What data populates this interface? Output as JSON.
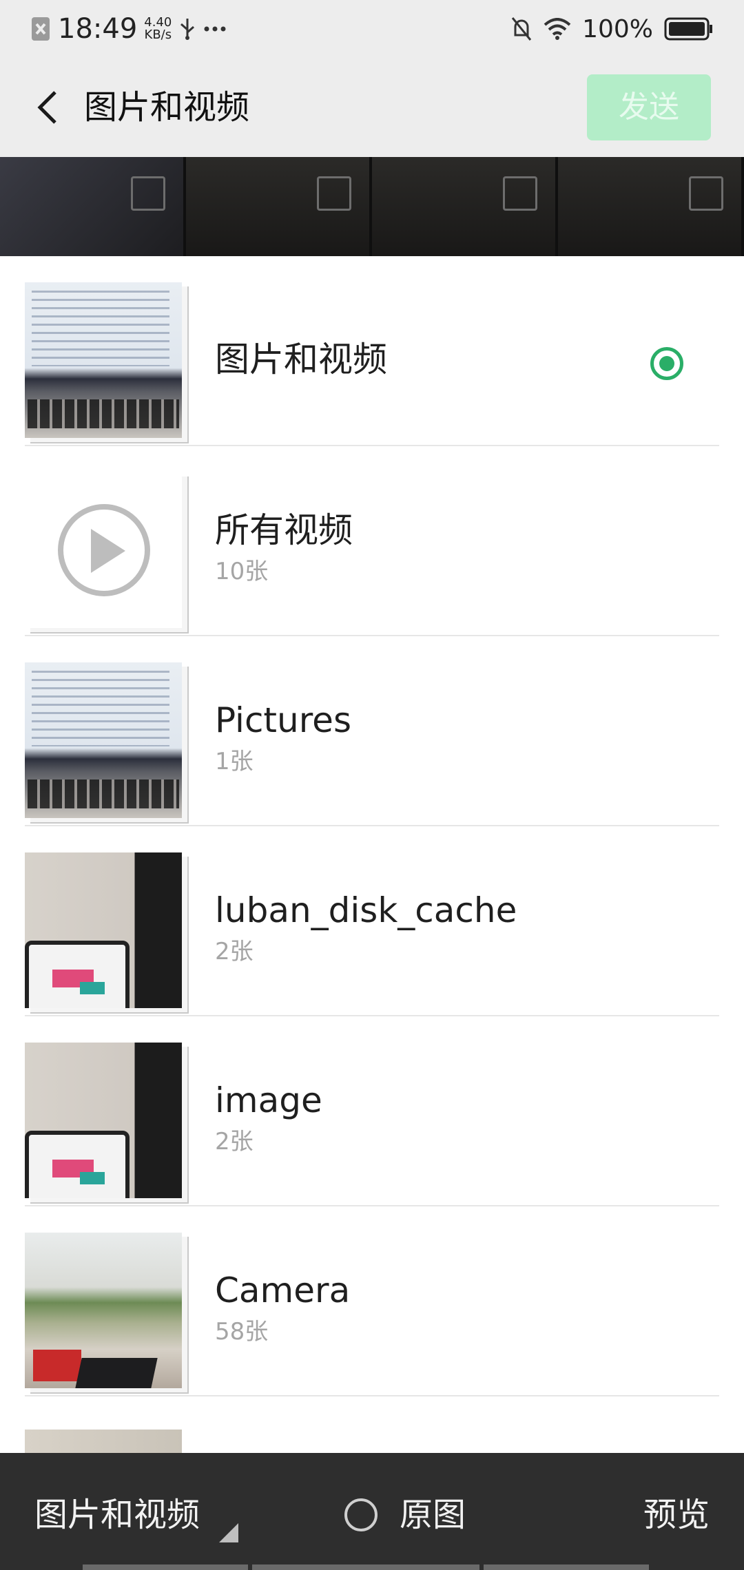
{
  "status_bar": {
    "time": "18:49",
    "net_speed_value": "4.40",
    "net_speed_unit": "KB/s",
    "battery": "100%",
    "icons": [
      "notification-icon",
      "usb-icon",
      "more-icon",
      "bell-off-icon",
      "wifi-icon",
      "battery-icon"
    ]
  },
  "header": {
    "title": "图片和视频",
    "send_label": "发送"
  },
  "albums": [
    {
      "name": "图片和视频",
      "count": "",
      "selected": true,
      "thumb": "laptop"
    },
    {
      "name": "所有视频",
      "count": "10张",
      "selected": false,
      "thumb": "video"
    },
    {
      "name": "Pictures",
      "count": "1张",
      "selected": false,
      "thumb": "laptop"
    },
    {
      "name": "luban_disk_cache",
      "count": "2张",
      "selected": false,
      "thumb": "desk"
    },
    {
      "name": "image",
      "count": "2张",
      "selected": false,
      "thumb": "desk"
    },
    {
      "name": "Camera",
      "count": "58张",
      "selected": false,
      "thumb": "office"
    }
  ],
  "bottom_bar": {
    "folder_label": "图片和视频",
    "original_label": "原图",
    "preview_label": "预览"
  },
  "colors": {
    "accent": "#2aae67",
    "send_disabled_bg": "#b3edc8",
    "bar_bg": "#ededed",
    "bottom_bg": "#2e2e2e"
  }
}
